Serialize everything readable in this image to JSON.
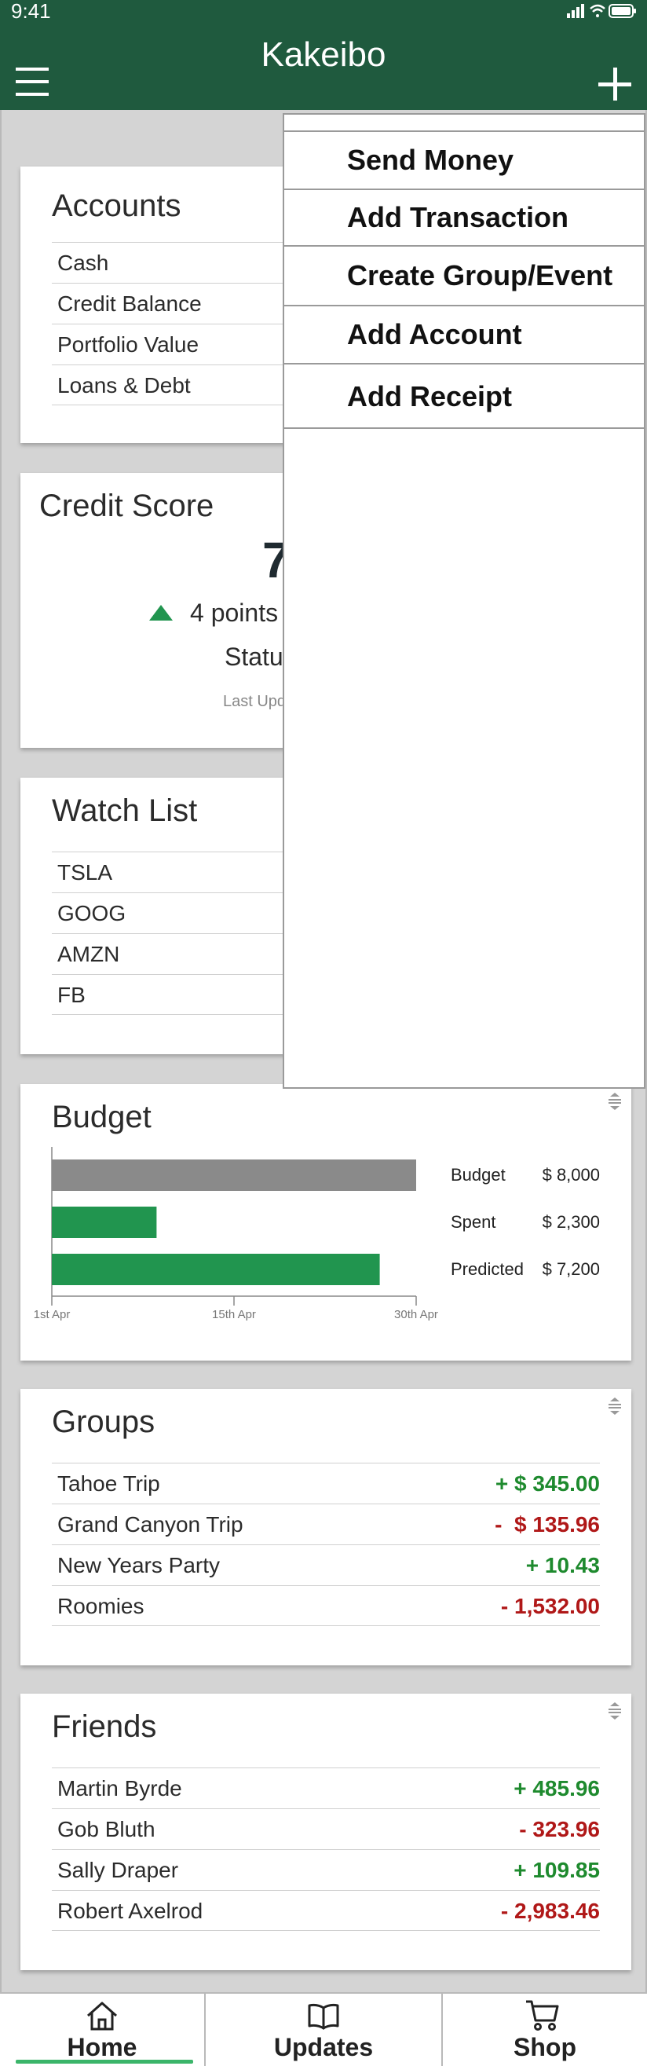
{
  "status_bar": {
    "time": "9:41"
  },
  "nav": {
    "title": "Kakeibo"
  },
  "menu": {
    "items": [
      {
        "label": "Send Money"
      },
      {
        "label": "Add Transaction"
      },
      {
        "label": "Create Group/Event"
      },
      {
        "label": "Add Account"
      },
      {
        "label": "Add Receipt"
      }
    ]
  },
  "accounts": {
    "title": "Accounts",
    "rows": [
      {
        "label": "Cash"
      },
      {
        "label": "Credit Balance"
      },
      {
        "label": "Portfolio Value"
      },
      {
        "label": "Loans & Debt"
      }
    ]
  },
  "credit": {
    "title": "Credit Score",
    "score_partial": "7",
    "change_partial": "4 points",
    "status_partial": "Statu",
    "updated_partial": "Last Upd",
    "up_color": "#1e8a2e"
  },
  "watchlist": {
    "title": "Watch List",
    "rows": [
      {
        "label": "TSLA"
      },
      {
        "label": "GOOG"
      },
      {
        "label": "AMZN"
      },
      {
        "label": "FB"
      }
    ]
  },
  "budget": {
    "title": "Budget",
    "chart_data": {
      "type": "bar",
      "orientation": "horizontal",
      "categories": [
        "Budget",
        "Spent",
        "Predicted"
      ],
      "values": [
        8000,
        2300,
        7200
      ],
      "value_labels": [
        "$ 8,000",
        "$ 2,300",
        "$ 7,200"
      ],
      "colors": [
        "#8a8a8a",
        "#21954f",
        "#21954f"
      ],
      "xlim": [
        0,
        8000
      ],
      "x_ticks": [
        "1st Apr",
        "15th Apr",
        "30th Apr"
      ]
    }
  },
  "groups": {
    "title": "Groups",
    "rows": [
      {
        "label": "Tahoe Trip",
        "value": "+ $ 345.00",
        "sign": "pos"
      },
      {
        "label": "Grand Canyon Trip",
        "value": "-  $ 135.96",
        "sign": "neg"
      },
      {
        "label": "New Years Party",
        "value": "+ 10.43",
        "sign": "pos"
      },
      {
        "label": "Roomies",
        "value": "- 1,532.00",
        "sign": "neg"
      }
    ]
  },
  "friends": {
    "title": "Friends",
    "rows": [
      {
        "label": "Martin Byrde",
        "value": "+ 485.96",
        "sign": "pos"
      },
      {
        "label": "Gob Bluth",
        "value": "- 323.96",
        "sign": "neg"
      },
      {
        "label": "Sally Draper",
        "value": "+ 109.85",
        "sign": "pos"
      },
      {
        "label": "Robert Axelrod",
        "value": "- 2,983.46",
        "sign": "neg"
      }
    ]
  },
  "tabbar": {
    "tabs": [
      {
        "label": "Home",
        "icon": "home-icon",
        "active": true
      },
      {
        "label": "Updates",
        "icon": "book-icon",
        "active": false
      },
      {
        "label": "Shop",
        "icon": "cart-icon",
        "active": false
      }
    ],
    "active_color": "#3bb56a"
  }
}
